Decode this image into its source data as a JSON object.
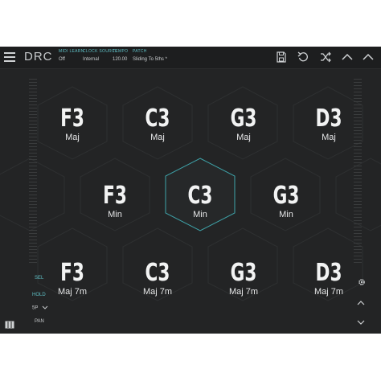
{
  "header": {
    "app_title": "DRC",
    "midi_learn": {
      "label": "MIDI LEARN",
      "value": "Off"
    },
    "clock_source": {
      "label": "CLOCK SOURCE",
      "value": "Internal"
    },
    "tempo": {
      "label": "TEMPO",
      "value": "120.00"
    },
    "patch": {
      "label": "PATCH",
      "value": "Sliding To 5ths *"
    }
  },
  "toolbar_icons": [
    "save-icon",
    "undo-icon",
    "shuffle-icon",
    "chevron-up-icon",
    "chevron-down-icon"
  ],
  "left_panel": {
    "sel": "SEL",
    "hold": "HOLD",
    "mode": "5P",
    "pan": "PAN"
  },
  "accent_color": "#5fc0c6",
  "chords": {
    "row1": [
      {
        "note": "F3",
        "quality": "Maj"
      },
      {
        "note": "C3",
        "quality": "Maj"
      },
      {
        "note": "G3",
        "quality": "Maj"
      },
      {
        "note": "D3",
        "quality": "Maj"
      }
    ],
    "row2": [
      {
        "note": "F3",
        "quality": "Min"
      },
      {
        "note": "C3",
        "quality": "Min"
      },
      {
        "note": "G3",
        "quality": "Min"
      }
    ],
    "row3": [
      {
        "note": "F3",
        "quality": "Maj 7m"
      },
      {
        "note": "C3",
        "quality": "Maj 7m"
      },
      {
        "note": "G3",
        "quality": "Maj 7m"
      },
      {
        "note": "D3",
        "quality": "Maj 7m"
      }
    ]
  },
  "active_chord": {
    "note": "C3",
    "quality": "Min"
  }
}
